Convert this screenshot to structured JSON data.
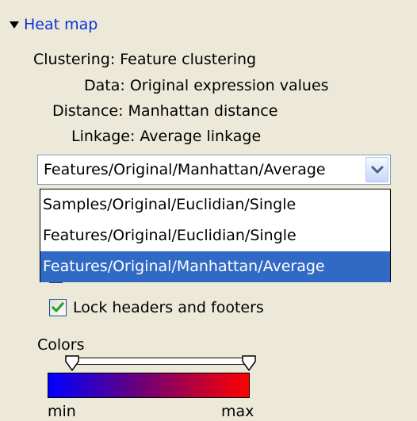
{
  "section": {
    "title": "Heat map",
    "expanded": true
  },
  "properties": {
    "clustering": {
      "label": "Clustering:",
      "value": "Feature clustering"
    },
    "data": {
      "label": "Data:",
      "value": "Original expression values"
    },
    "distance": {
      "label": "Distance:",
      "value": "Manhattan distance"
    },
    "linkage": {
      "label": "Linkage:",
      "value": "Average linkage"
    }
  },
  "clustering_select": {
    "selected": "Features/Original/Manhattan/Average",
    "options": [
      "Samples/Original/Euclidian/Single",
      "Features/Original/Euclidian/Single",
      "Features/Original/Manhattan/Average"
    ],
    "selected_index": 2
  },
  "lock_headers": {
    "label": "Lock headers and footers",
    "checked": true
  },
  "colors": {
    "label": "Colors",
    "min_label": "min",
    "max_label": "max",
    "gradient": [
      "#0000ff",
      "#ff0000"
    ]
  },
  "theme": {
    "background": "#ece9d8",
    "link": "#0b2fe0",
    "selection": "#316ac5",
    "check": "#21a121"
  },
  "icons": {
    "expand": "triangle-down-icon",
    "dropdown": "chevron-down-icon",
    "check": "checkmark-icon"
  }
}
